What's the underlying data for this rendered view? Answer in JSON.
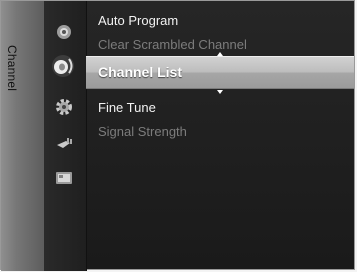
{
  "sidebar": {
    "label": "Channel"
  },
  "icons": [
    {
      "name": "picture-icon"
    },
    {
      "name": "channel-antenna-icon"
    },
    {
      "name": "setup-gear-icon"
    },
    {
      "name": "input-plug-icon"
    },
    {
      "name": "application-icon"
    }
  ],
  "menu": {
    "items": [
      {
        "label": "Auto Program",
        "state": "enabled"
      },
      {
        "label": "Clear Scrambled Channel",
        "state": "disabled"
      },
      {
        "label": "Channel List",
        "state": "selected"
      },
      {
        "label": "Fine Tune",
        "state": "enabled"
      },
      {
        "label": "Signal Strength",
        "state": "disabled"
      }
    ]
  },
  "colors": {
    "background": "#1f1f1f",
    "selected_bar": "#bdbdbd",
    "enabled_text": "#f2f2f2",
    "disabled_text": "#7c7c7c"
  }
}
